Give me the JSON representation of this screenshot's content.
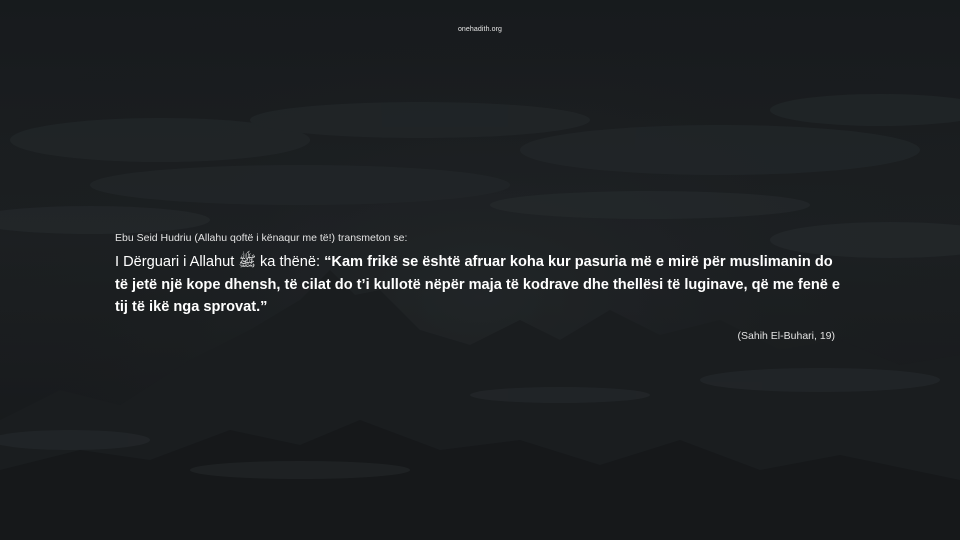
{
  "site": {
    "domain": "onehadith.org"
  },
  "hadith": {
    "narrator_line": "Ebu Seid Hudriu (Allahu qoftë i kënaqur me të!) transmeton se:",
    "intro": "I Dërguari i Allahut ﷺ ka thënë: ",
    "quote": "“Kam frikë se është afruar koha kur pasuria më e mirë për muslimanin do të jetë një kope dhensh, të cilat do t’i kullotë nëpër maja të kodrave dhe thellësi të luginave, që me fenë e tij të ikë nga sprovat.”",
    "source": "(Sahih El-Buhari, 19)"
  },
  "colors": {
    "background": "#1f2326",
    "text": "#ffffff",
    "secondary_text": "#e3e3e3"
  }
}
